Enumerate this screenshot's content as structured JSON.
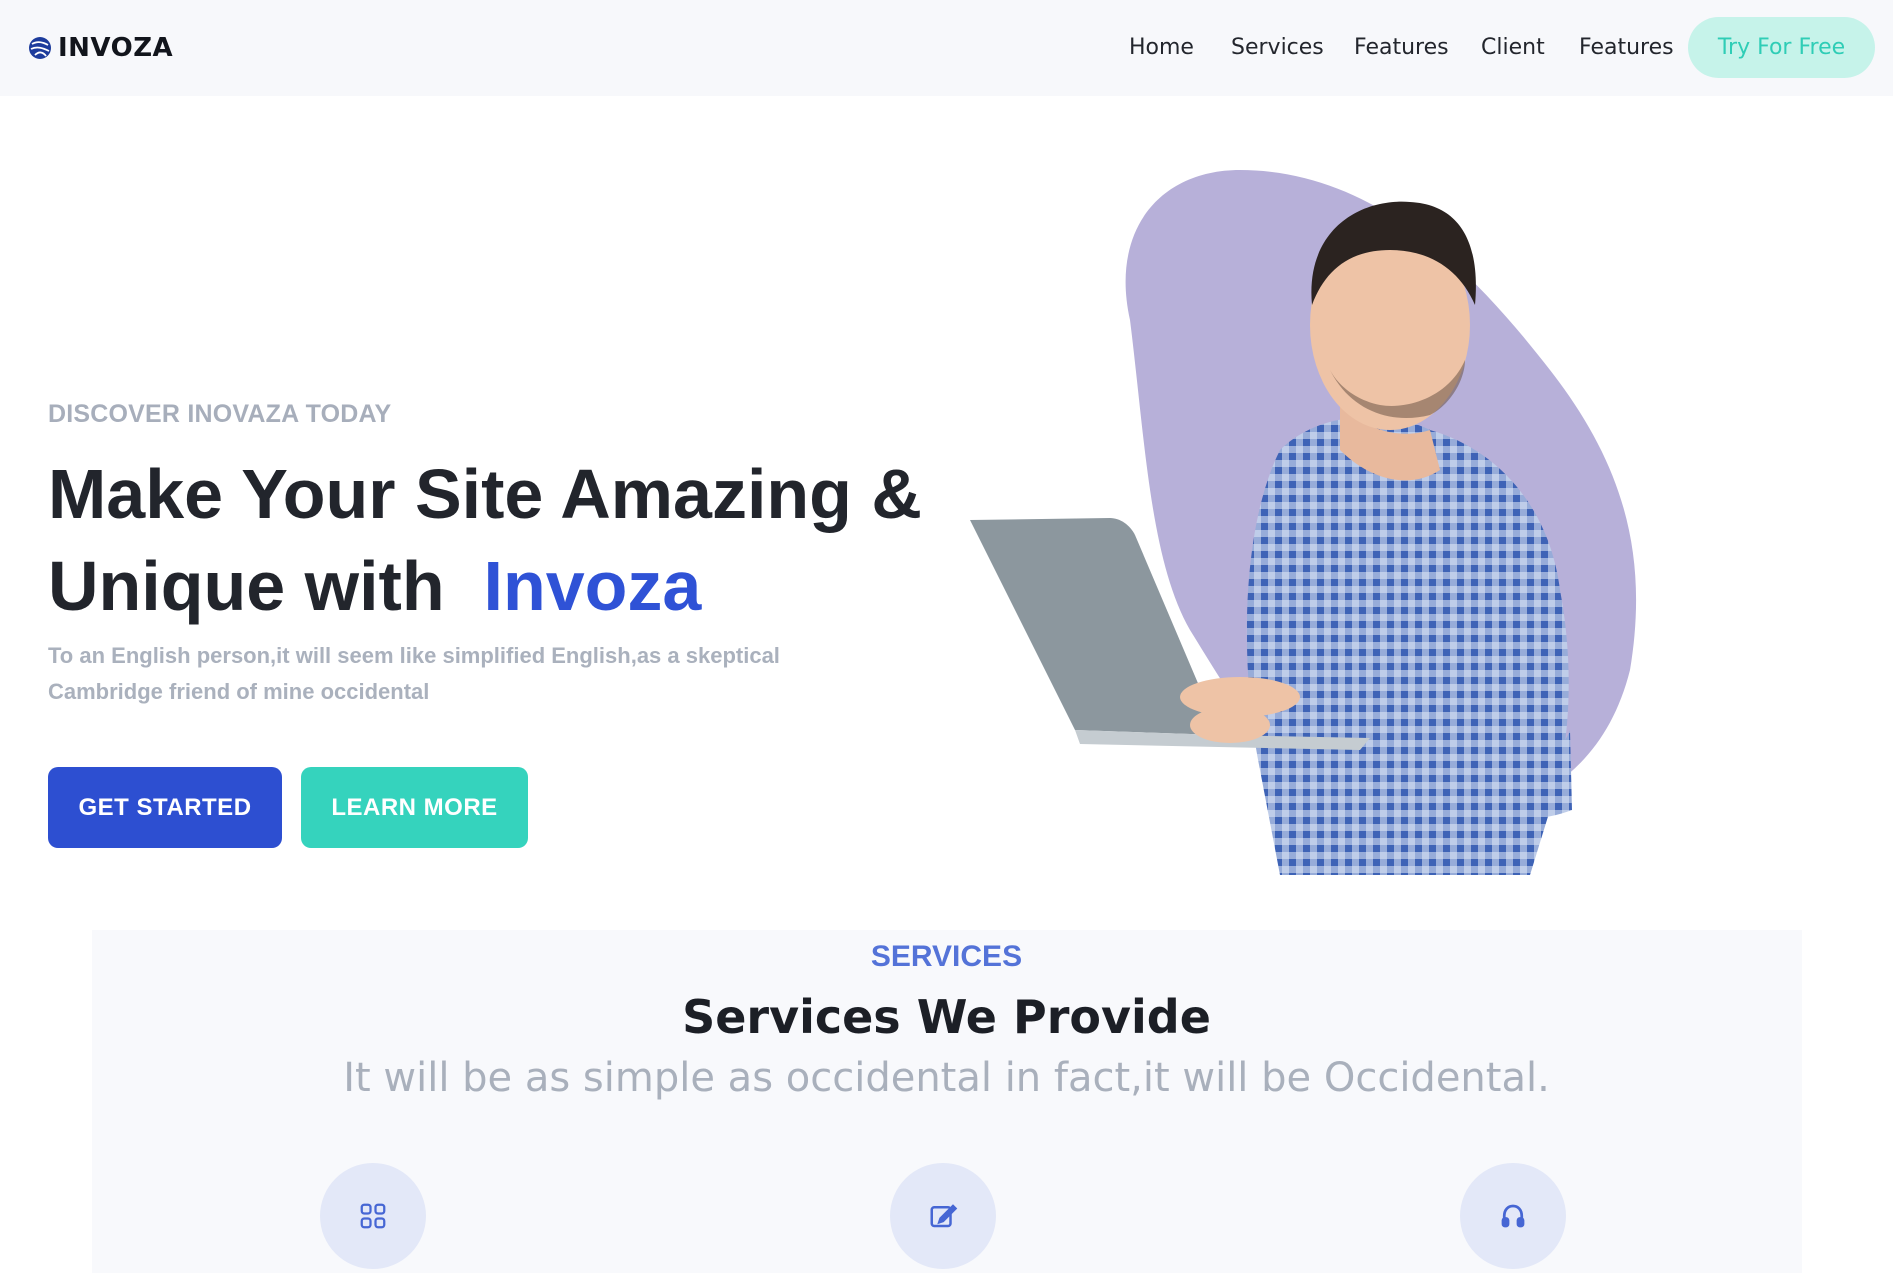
{
  "navbar": {
    "brand": "INVOZA",
    "links": [
      "Home",
      "Services",
      "Features",
      "Client",
      "Features"
    ],
    "cta_label": "Try For Free"
  },
  "hero": {
    "eyebrow": "DISCOVER INOVAZA TODAY",
    "title_line1": "Make Your Site Amazing &",
    "title_line2_prefix": "Unique with",
    "title_accent": "Invoza",
    "subtitle": "To an English person,it will seem like simplified English,as a skeptical Cambridge friend of mine occidental",
    "primary_button": "GET STARTED",
    "secondary_button": "LEARN MORE"
  },
  "services": {
    "eyebrow": "SERVICES",
    "title": "Services We Provide",
    "subtitle": "It will be as simple as occidental in fact,it will be Occidental.",
    "icons": [
      "grid-icon",
      "edit-icon",
      "headphones-icon"
    ]
  },
  "colors": {
    "primary": "#2d4fd1",
    "accent": "#35d3bd",
    "blob": "#b7b0d9"
  }
}
